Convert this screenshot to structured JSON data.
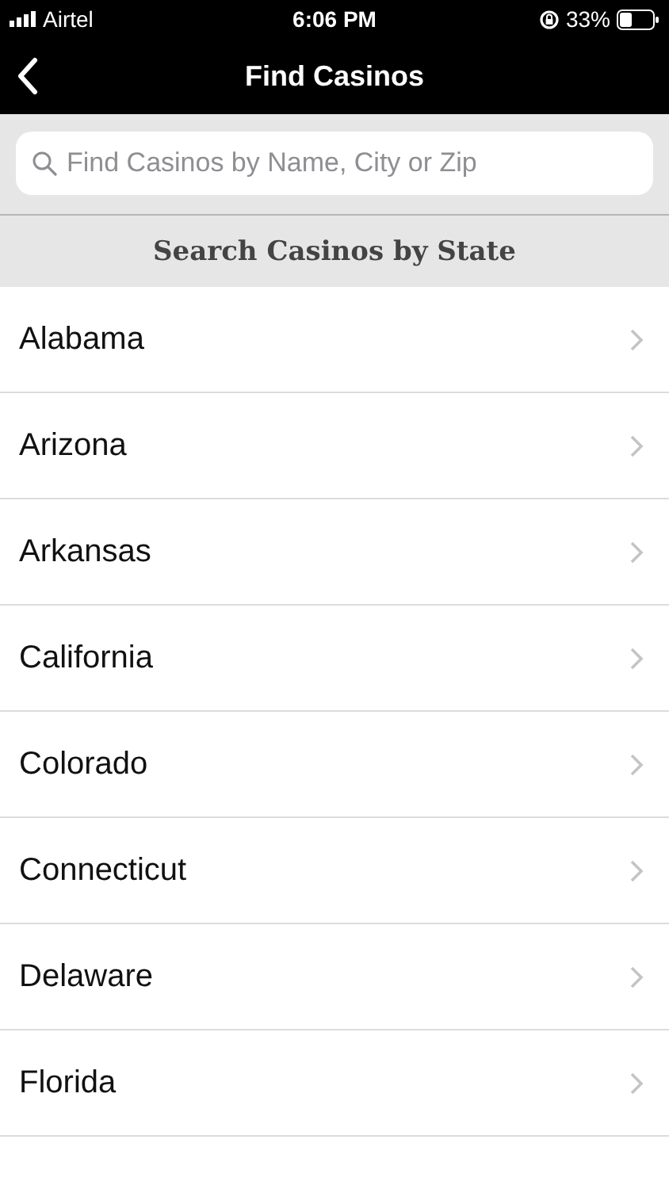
{
  "status_bar": {
    "carrier": "Airtel",
    "time": "6:06 PM",
    "battery": "33%"
  },
  "nav": {
    "title": "Find Casinos"
  },
  "search": {
    "placeholder": "Find Casinos by Name, City or Zip"
  },
  "section_header": "Search Casinos by State",
  "states": [
    {
      "name": "Alabama"
    },
    {
      "name": "Arizona"
    },
    {
      "name": "Arkansas"
    },
    {
      "name": "California"
    },
    {
      "name": "Colorado"
    },
    {
      "name": "Connecticut"
    },
    {
      "name": "Delaware"
    },
    {
      "name": "Florida"
    }
  ]
}
